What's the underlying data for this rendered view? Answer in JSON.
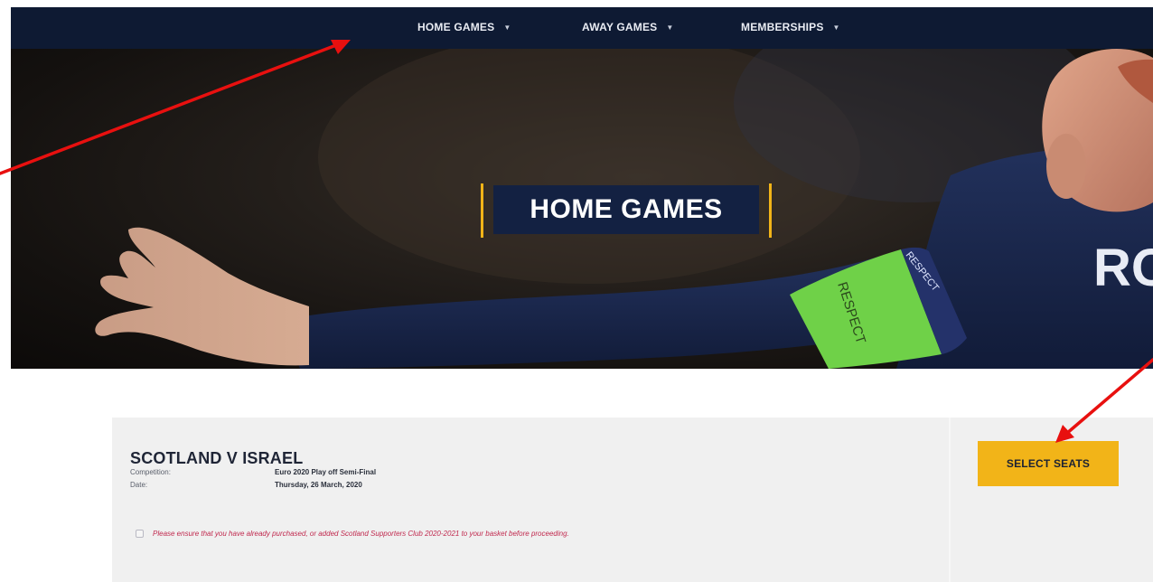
{
  "nav": {
    "items": [
      {
        "label": "HOME GAMES"
      },
      {
        "label": "AWAY GAMES"
      },
      {
        "label": "MEMBERSHIPS"
      }
    ],
    "chevron": "▼"
  },
  "hero": {
    "title": "HOME GAMES",
    "armband_text": "RESPECT",
    "shirt_lettering": "RO"
  },
  "match": {
    "title": "SCOTLAND V ISRAEL",
    "competition_label": "Competition:",
    "competition_value": "Euro 2020 Play off Semi-Final",
    "date_label": "Date:",
    "date_value": "Thursday, 26 March, 2020",
    "notice": "Please ensure that you have already purchased, or added Scotland Supporters Club 2020-2021 to your basket before proceeding.",
    "select_label": "SELECT SEATS"
  },
  "colors": {
    "nav_bg": "#0e1a33",
    "accent_gold": "#f2b418",
    "title_box": "#132142",
    "notice_red": "#c0294e",
    "annotation_red": "#e8100f"
  }
}
